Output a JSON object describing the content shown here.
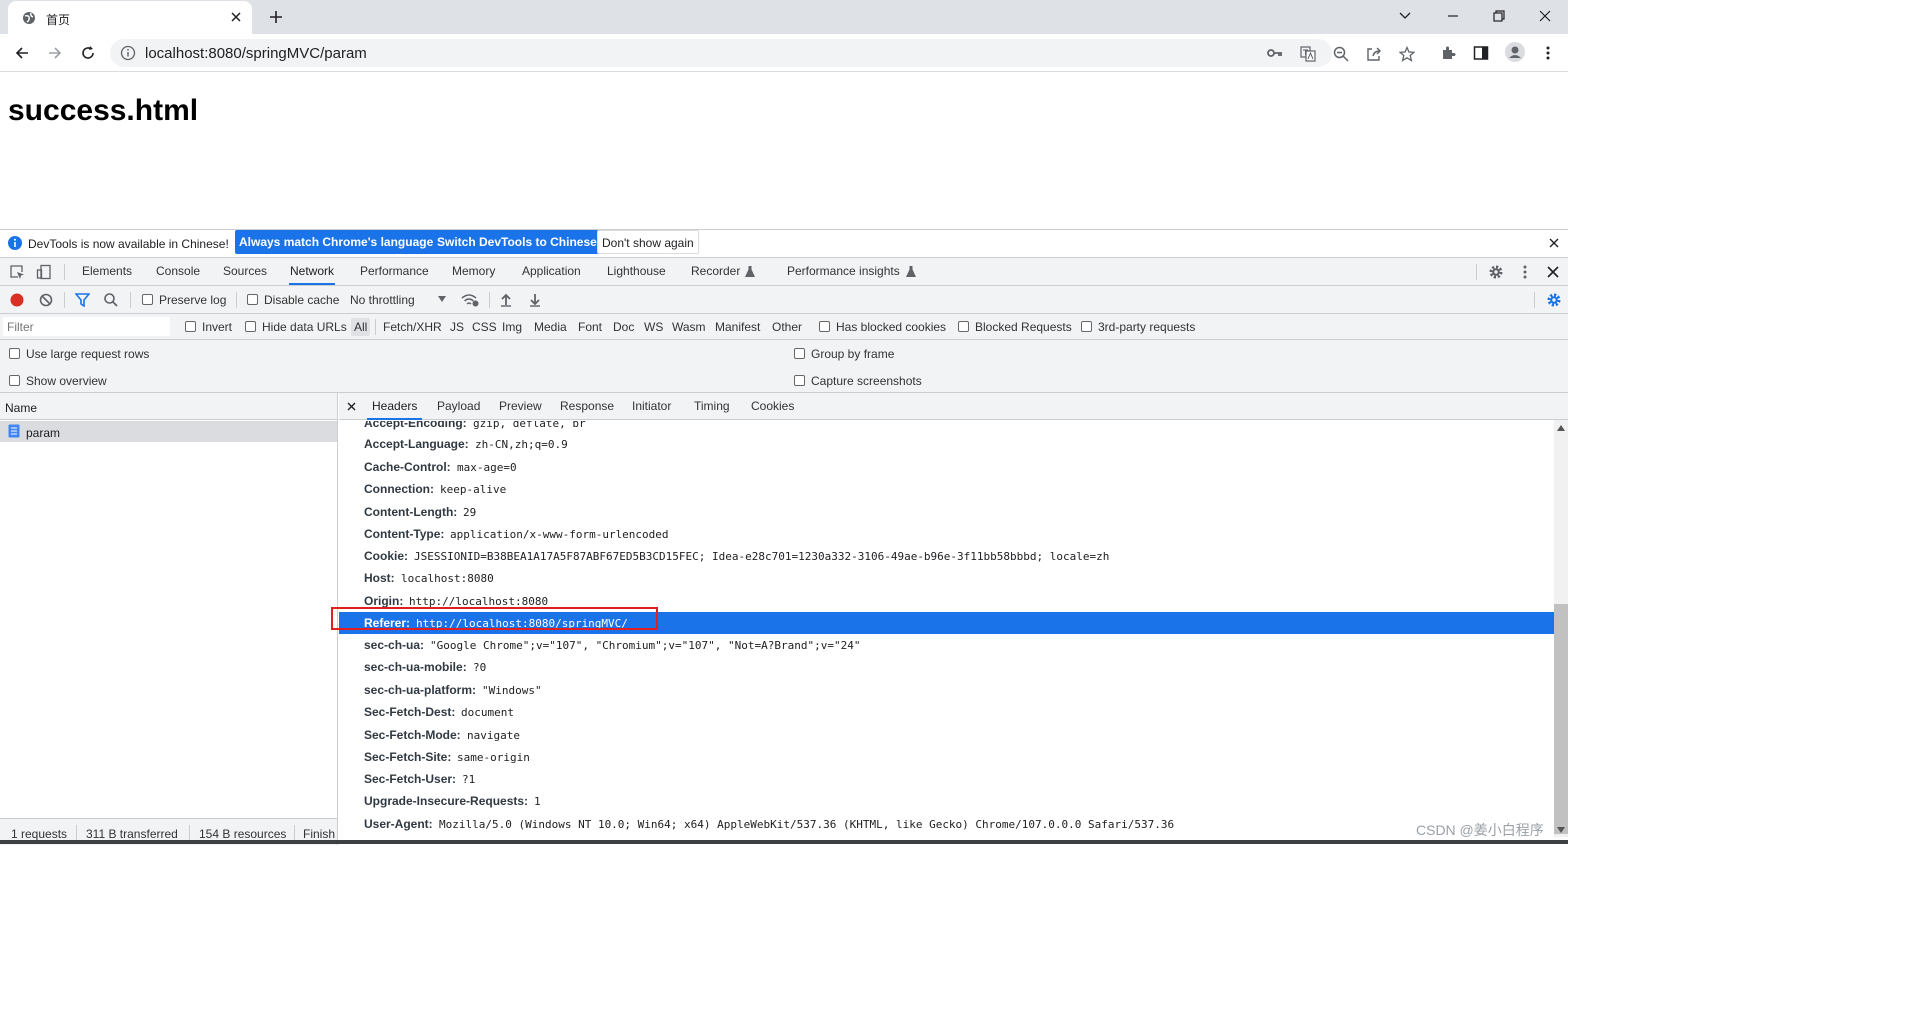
{
  "browser": {
    "tab_title": "首页",
    "url": "localhost:8080/springMVC/param"
  },
  "page": {
    "heading": "success.html"
  },
  "devtools": {
    "infobar": {
      "message": "DevTools is now available in Chinese!",
      "btn_match": "Always match Chrome's language",
      "btn_switch": "Switch DevTools to Chinese",
      "btn_dismiss": "Don't show again"
    },
    "tabs": [
      "Elements",
      "Console",
      "Sources",
      "Network",
      "Performance",
      "Memory",
      "Application",
      "Lighthouse",
      "Recorder",
      "Performance insights"
    ],
    "active_tab": "Network",
    "network_toolbar": {
      "preserve_log": "Preserve log",
      "disable_cache": "Disable cache",
      "throttling": "No throttling"
    },
    "filter": {
      "placeholder": "Filter",
      "invert": "Invert",
      "hide_data_urls": "Hide data URLs",
      "types": [
        "All",
        "Fetch/XHR",
        "JS",
        "CSS",
        "Img",
        "Media",
        "Font",
        "Doc",
        "WS",
        "Wasm",
        "Manifest",
        "Other"
      ],
      "has_blocked_cookies": "Has blocked cookies",
      "blocked_requests": "Blocked Requests",
      "third_party": "3rd-party requests"
    },
    "options": {
      "large_rows": "Use large request rows",
      "overview": "Show overview",
      "group_by_frame": "Group by frame",
      "capture_screenshots": "Capture screenshots"
    },
    "requests": {
      "column_name": "Name",
      "items": [
        "param"
      ]
    },
    "status": {
      "requests": "1 requests",
      "transferred": "311 B transferred",
      "resources": "154 B resources",
      "finish": "Finish"
    },
    "detail_tabs": [
      "Headers",
      "Payload",
      "Preview",
      "Response",
      "Initiator",
      "Timing",
      "Cookies"
    ],
    "headers": [
      {
        "key": "Accept-Encoding:",
        "value": "gzip, deflate, br"
      },
      {
        "key": "Accept-Language:",
        "value": "zh-CN,zh;q=0.9"
      },
      {
        "key": "Cache-Control:",
        "value": "max-age=0"
      },
      {
        "key": "Connection:",
        "value": "keep-alive"
      },
      {
        "key": "Content-Length:",
        "value": "29"
      },
      {
        "key": "Content-Type:",
        "value": "application/x-www-form-urlencoded"
      },
      {
        "key": "Cookie:",
        "value": "JSESSIONID=B38BEA1A17A5F87ABF67ED5B3CD15FEC; Idea-e28c701=1230a332-3106-49ae-b96e-3f11bb58bbbd; locale=zh"
      },
      {
        "key": "Host:",
        "value": "localhost:8080"
      },
      {
        "key": "Origin:",
        "value": "http://localhost:8080"
      },
      {
        "key": "Referer:",
        "value": "http://localhost:8080/springMVC/"
      },
      {
        "key": "sec-ch-ua:",
        "value": "\"Google Chrome\";v=\"107\", \"Chromium\";v=\"107\", \"Not=A?Brand\";v=\"24\""
      },
      {
        "key": "sec-ch-ua-mobile:",
        "value": "?0"
      },
      {
        "key": "sec-ch-ua-platform:",
        "value": "\"Windows\""
      },
      {
        "key": "Sec-Fetch-Dest:",
        "value": "document"
      },
      {
        "key": "Sec-Fetch-Mode:",
        "value": "navigate"
      },
      {
        "key": "Sec-Fetch-Site:",
        "value": "same-origin"
      },
      {
        "key": "Sec-Fetch-User:",
        "value": "?1"
      },
      {
        "key": "Upgrade-Insecure-Requests:",
        "value": "1"
      },
      {
        "key": "User-Agent:",
        "value": "Mozilla/5.0 (Windows NT 10.0; Win64; x64) AppleWebKit/537.36 (KHTML, like Gecko) Chrome/107.0.0.0 Safari/537.36"
      }
    ],
    "selected_header": "Referer:"
  },
  "watermark": "CSDN @姜小白程序"
}
